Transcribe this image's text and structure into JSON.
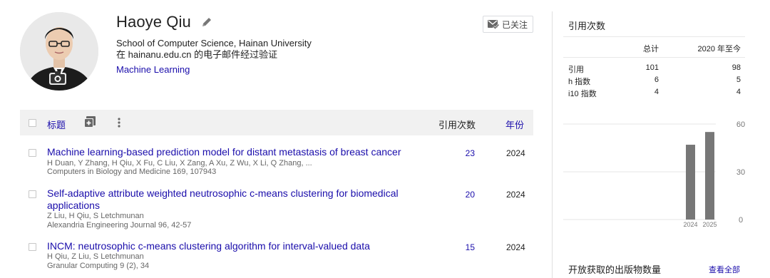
{
  "profile": {
    "name": "Haoye Qiu",
    "affiliation": "School of Computer Science, Hainan University",
    "email_verified": "在 hainanu.edu.cn 的电子邮件经过验证",
    "interest": "Machine Learning",
    "follow_label": "已关注"
  },
  "table": {
    "header": {
      "title": "标题",
      "cited_by": "引用次数",
      "year": "年份"
    },
    "rows": [
      {
        "title": "Machine learning-based prediction model for distant metastasis of breast cancer",
        "authors": "H Duan, Y Zhang, H Qiu, X Fu, C Liu, X Zang, A Xu, Z Wu, X Li, Q Zhang, ...",
        "venue": "Computers in Biology and Medicine 169, 107943",
        "citations": "23",
        "year": "2024"
      },
      {
        "title": "Self-adaptive attribute weighted neutrosophic c-means clustering for biomedical applications",
        "authors": "Z Liu, H Qiu, S Letchmunan",
        "venue": "Alexandria Engineering Journal 96, 42-57",
        "citations": "20",
        "year": "2024"
      },
      {
        "title": "INCM: neutrosophic c-means clustering algorithm for interval-valued data",
        "authors": "H Qiu, Z Liu, S Letchmunan",
        "venue": "Granular Computing 9 (2), 34",
        "citations": "15",
        "year": "2024"
      }
    ]
  },
  "metrics": {
    "title": "引用次数",
    "col_total": "总计",
    "col_since": "2020 年至今",
    "rows": [
      {
        "label": "引用",
        "total": "101",
        "since": "98"
      },
      {
        "label": "h 指数",
        "total": "6",
        "since": "5"
      },
      {
        "label": "i10 指数",
        "total": "4",
        "since": "4"
      }
    ]
  },
  "chart_data": {
    "type": "bar",
    "categories": [
      "2024",
      "2025"
    ],
    "values": [
      47,
      55
    ],
    "ylim": [
      0,
      60
    ],
    "yticks": [
      "60",
      "30",
      "0"
    ],
    "grid": true
  },
  "open_access": {
    "title": "开放获取的出版物数量",
    "view_all": "查看全部"
  },
  "colors": {
    "link": "#1a0dab",
    "bar": "#777777",
    "header_bg": "#f1f1f1"
  }
}
